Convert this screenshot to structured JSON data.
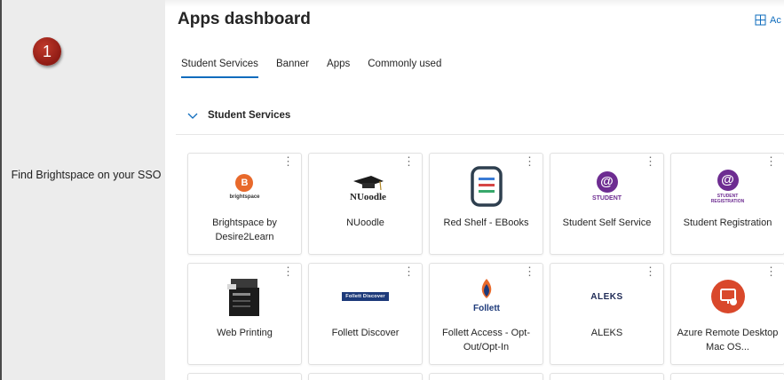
{
  "left_panel": {
    "step_number": "1",
    "instruction": "Find Brightspace on your SSO"
  },
  "header": {
    "title": "Apps dashboard",
    "add_label": "Ac"
  },
  "tabs": [
    {
      "label": "Student Services",
      "active": true
    },
    {
      "label": "Banner",
      "active": false
    },
    {
      "label": "Apps",
      "active": false
    },
    {
      "label": "Commonly used",
      "active": false
    }
  ],
  "section": {
    "title": "Student Services"
  },
  "tiles": [
    {
      "name": "Brightspace by Desire2Learn",
      "logo_text": "brightspace",
      "icon": "brightspace-icon"
    },
    {
      "name": "NUoodle",
      "logo_text": "NUoodle",
      "icon": "nuoodle-icon"
    },
    {
      "name": "Red Shelf - EBooks",
      "icon": "redshelf-icon"
    },
    {
      "name": "Student Self Service",
      "logo_text": "STUDENT",
      "icon": "student-self-service-icon"
    },
    {
      "name": "Student Registration",
      "logo_text": "STUDENT REGISTRATION",
      "icon": "student-registration-icon"
    },
    {
      "name": "Web Printing",
      "icon": "printer-icon"
    },
    {
      "name": "Follett Discover",
      "logo_text": "Follett  Discover",
      "icon": "follett-discover-icon"
    },
    {
      "name": "Follett Access - Opt-Out/Opt-In",
      "logo_text": "Follett",
      "icon": "follett-access-icon"
    },
    {
      "name": "ALEKS",
      "logo_text": "ALEKS",
      "icon": "aleks-icon"
    },
    {
      "name": "Azure Remote Desktop Mac OS...",
      "icon": "remote-desktop-icon"
    }
  ],
  "colors": {
    "accent": "#0f6cbd",
    "badge": "#a52a1f",
    "student_purple": "#6d2c91",
    "brightspace_orange": "#e8692b",
    "azure_red": "#d9482b"
  }
}
